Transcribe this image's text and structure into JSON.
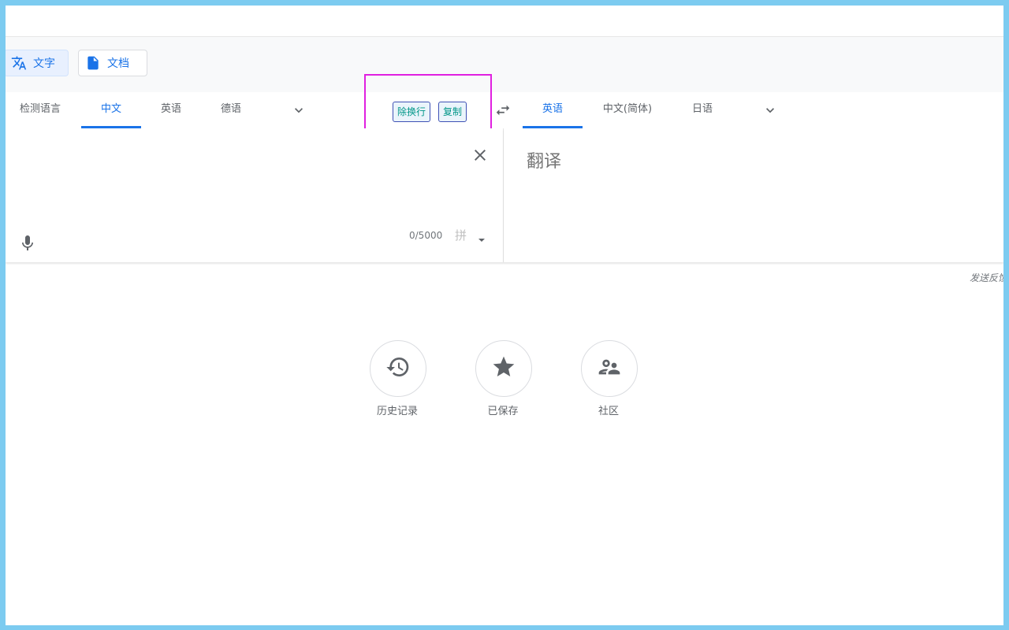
{
  "modes": [
    {
      "label": "文字",
      "icon": "translate-icon"
    },
    {
      "label": "文档",
      "icon": "document-icon"
    }
  ],
  "source_langs": [
    "检测语言",
    "中文",
    "英语",
    "德语"
  ],
  "target_langs": [
    "英语",
    "中文(简体)",
    "日语"
  ],
  "extension_buttons": {
    "remove_linebreaks": "除换行",
    "copy": "复制"
  },
  "input": {
    "counter": "0/5000",
    "pinyin": "拼"
  },
  "output": {
    "placeholder": "翻译"
  },
  "feedback": "发送反馈",
  "shortcuts": [
    {
      "label": "历史记录",
      "icon": "history-icon"
    },
    {
      "label": "已保存",
      "icon": "star-icon"
    },
    {
      "label": "社区",
      "icon": "community-icon"
    }
  ],
  "colors": {
    "accent": "#1a73e8",
    "highlight_box": "#e020e0",
    "frame": "#7ccbf0"
  }
}
